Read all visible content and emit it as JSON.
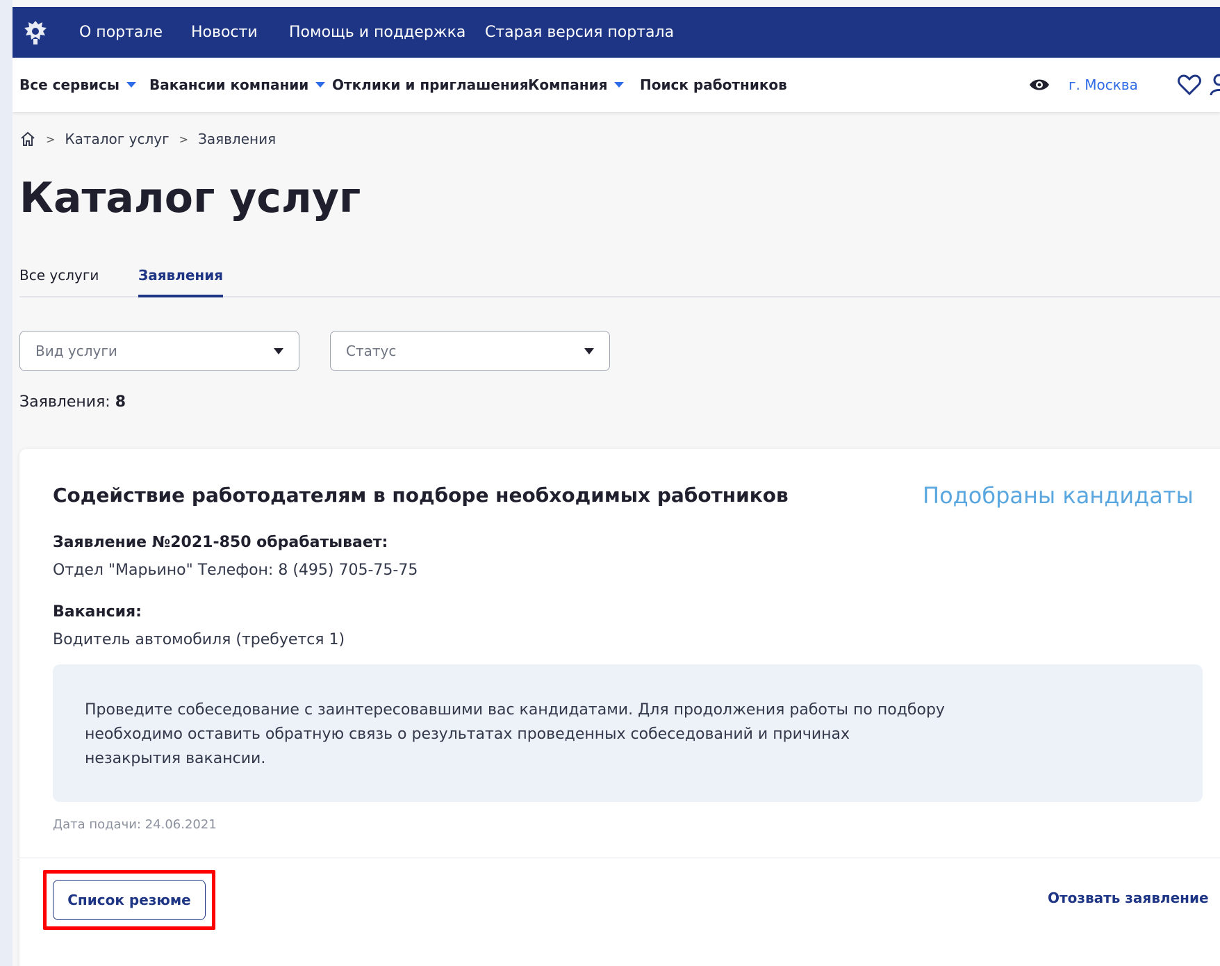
{
  "topbar": {
    "links": [
      "О портале",
      "Новости",
      "Помощь и поддержка",
      "Старая версия портала"
    ]
  },
  "subnav": {
    "items": [
      {
        "label": "Все сервисы",
        "has_dropdown": true
      },
      {
        "label": "Вакансии компании",
        "has_dropdown": true
      },
      {
        "label": "Отклики и приглашения",
        "has_dropdown": false
      },
      {
        "label": "Компания",
        "has_dropdown": true
      },
      {
        "label": "Поиск работников",
        "has_dropdown": false
      }
    ],
    "city": "г. Москва",
    "icons": [
      "eye-icon",
      "heart-icon",
      "user-icon"
    ]
  },
  "breadcrumb": {
    "items": [
      "Каталог услуг",
      "Заявления"
    ],
    "separator": ">"
  },
  "page_title": "Каталог услуг",
  "tabs": [
    {
      "label": "Все услуги",
      "active": false
    },
    {
      "label": "Заявления",
      "active": true
    }
  ],
  "filters": {
    "service_type": {
      "placeholder": "Вид услуги"
    },
    "status": {
      "placeholder": "Статус"
    }
  },
  "count": {
    "label": "Заявления:",
    "value": "8"
  },
  "application": {
    "title": "Содействие работодателям в подборе необходимых работников",
    "status": "Подобраны кандидаты",
    "handler_label": "Заявление №2021-850 обрабатывает:",
    "handler_value": "Отдел \"Марьино\" Телефон: 8 (495) 705-75-75",
    "vacancy_label": "Вакансия:",
    "vacancy_value": "Водитель автомобиля (требуется 1)",
    "note": "Проведите собеседование с заинтересовавшими вас кандидатами. Для продолжения работы по подбору необходимо оставить обратную связь о результатах проведенных собеседований и причинах незакрытия вакансии.",
    "date": "Дата подачи: 24.06.2021",
    "resume_button": "Список резюме",
    "revoke_link": "Отозвать заявление"
  },
  "colors": {
    "header_bg": "#1d3584",
    "accent_blue": "#2e6be6",
    "status_blue": "#5aa7e0",
    "note_bg": "#edf2f9",
    "highlight_red": "#ff0000"
  }
}
